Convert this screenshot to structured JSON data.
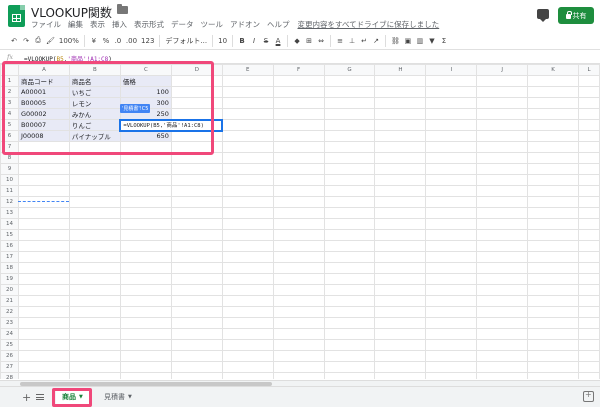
{
  "app": {
    "title": "VLOOKUP関数",
    "menu": [
      "ファイル",
      "編集",
      "表示",
      "挿入",
      "表示形式",
      "データ",
      "ツール",
      "アドオン",
      "ヘルプ"
    ],
    "save_status": "変更内容をすべてドライブに保存しました",
    "share_label": "共有"
  },
  "toolbar": {
    "zoom": "100%",
    "currency": "¥",
    "percent": "%",
    "decimal_less": ".0",
    "decimal_more": ".00",
    "number_format": "123",
    "font": "デフォルト...",
    "font_size": "10",
    "bold": "B",
    "italic": "I",
    "strike": "S",
    "text_color": "A"
  },
  "formula_bar": {
    "fx": "fx",
    "prefix": "=VLOOKUP(",
    "ref": "B5",
    "sep": ",",
    "range": "'商品'!A1:C8",
    "suffix": ")"
  },
  "grid": {
    "columns": [
      "A",
      "B",
      "C",
      "D",
      "E",
      "F",
      "G",
      "H",
      "I",
      "J",
      "K",
      "L"
    ],
    "rows": [
      [
        "商品コード",
        "商品名",
        "価格"
      ],
      [
        "A00001",
        "いちご",
        "100"
      ],
      [
        "B00005",
        "レモン",
        "300"
      ],
      [
        "G00002",
        "みかん",
        "250"
      ],
      [
        "B00007",
        "りんご",
        "=VLOOKUP(B5,'商品'!A1:C8)"
      ],
      [
        "J00008",
        "パイナップル",
        "650"
      ]
    ],
    "total_rows": 29,
    "tooltip": "'見積書'!C5"
  },
  "sheets": {
    "active": "商品",
    "other": "見積書"
  },
  "colors": {
    "accent": "#1a73e8",
    "highlight": "#f0487a",
    "share": "#1e8e3e"
  }
}
